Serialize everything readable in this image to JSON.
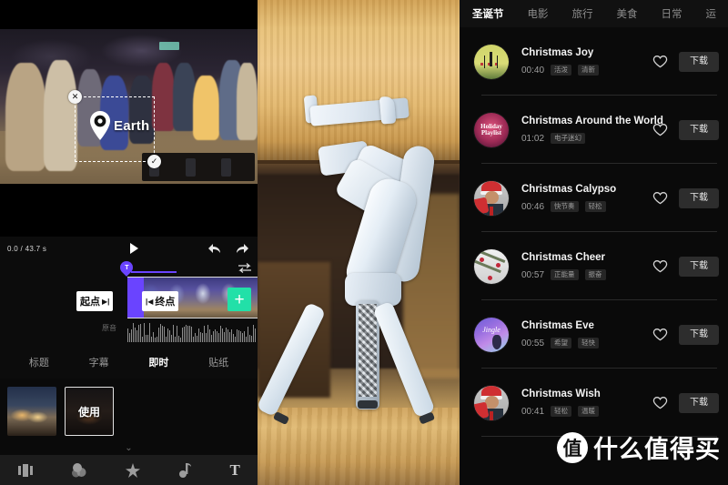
{
  "editor": {
    "preview": {
      "overlay_text": "Earth",
      "pin_icon": "location-pin-icon",
      "close_icon": "close-icon",
      "confirm_icon": "check-icon"
    },
    "timeline": {
      "time_readout": "0.0 / 43.7 s",
      "play_icon": "play-icon",
      "undo_icon": "undo-icon",
      "redo_icon": "redo-icon",
      "swap_icon": "swap-arrows-icon",
      "text_marker_glyph": "T",
      "start_handle": "起点",
      "end_handle": "终点",
      "add_clip_label": "+",
      "audio_track_label": "原音"
    },
    "effect_tabs": [
      {
        "label": "标题",
        "active": false
      },
      {
        "label": "字幕",
        "active": false
      },
      {
        "label": "即时",
        "active": true
      },
      {
        "label": "贴纸",
        "active": false
      }
    ],
    "effect_items": [
      {
        "label": "",
        "selected": false
      },
      {
        "label": "使用",
        "selected": true
      }
    ],
    "collapse_icon": "chevron-double-down-icon",
    "bottom_nav": [
      {
        "icon": "clip-edit-icon",
        "label": ""
      },
      {
        "icon": "filter-icon",
        "label": ""
      },
      {
        "icon": "effects-sparkle-icon",
        "label": ""
      },
      {
        "icon": "music-note-icon",
        "label": ""
      },
      {
        "icon": "text-icon",
        "label": "T"
      }
    ]
  },
  "music": {
    "tabs": [
      {
        "label": "圣诞节",
        "active": true
      },
      {
        "label": "电影",
        "active": false
      },
      {
        "label": "旅行",
        "active": false
      },
      {
        "label": "美食",
        "active": false
      },
      {
        "label": "日常",
        "active": false
      },
      {
        "label": "运",
        "active": false
      }
    ],
    "download_label": "下载",
    "heart_icon": "heart-outline-icon",
    "tracks": [
      {
        "title": "Christmas Joy",
        "duration": "00:40",
        "tags": [
          "活泼",
          "清新"
        ],
        "art": "art1"
      },
      {
        "title": "Christmas Around the World",
        "duration": "01:02",
        "tags": [
          "电子迷幻"
        ],
        "art": "art2"
      },
      {
        "title": "Christmas Calypso",
        "duration": "00:46",
        "tags": [
          "快节奏",
          "轻松"
        ],
        "art": "art3"
      },
      {
        "title": "Christmas Cheer",
        "duration": "00:57",
        "tags": [
          "正能量",
          "振奋"
        ],
        "art": "art4"
      },
      {
        "title": "Christmas Eve",
        "duration": "00:55",
        "tags": [
          "希望",
          "轻快"
        ],
        "art": "art5"
      },
      {
        "title": "Christmas Wish",
        "duration": "00:41",
        "tags": [
          "轻松",
          "温暖"
        ],
        "art": "art3"
      }
    ]
  },
  "watermark": {
    "logo_char": "值",
    "text": "什么值得买"
  },
  "colors": {
    "accent_purple": "#6a44ff",
    "accent_green": "#22e0a8",
    "panel_bg": "#0a0a0a",
    "tag_bg": "#262626",
    "download_bg": "#2d2d2d"
  }
}
